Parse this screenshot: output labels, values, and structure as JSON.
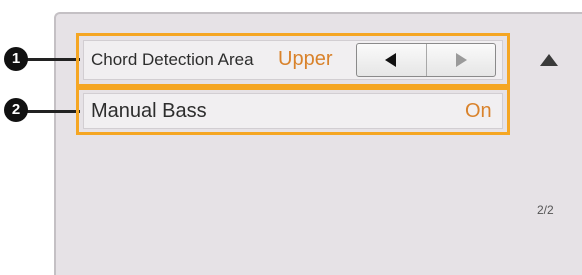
{
  "callouts": [
    "1",
    "2"
  ],
  "rows": [
    {
      "label": "Chord Detection Area",
      "value": "Upper"
    },
    {
      "label": "Manual Bass",
      "value": "On"
    }
  ],
  "arrow_buttons": {
    "left_icon": "triangle-left-icon",
    "right_icon": "triangle-right-icon"
  },
  "scroll": {
    "up_icon": "triangle-up-icon"
  },
  "page_indicator": "2/2",
  "colors": {
    "highlight_outline": "#f5a623",
    "value_text": "#d9822b",
    "screen_bg": "#e6e2e6"
  }
}
